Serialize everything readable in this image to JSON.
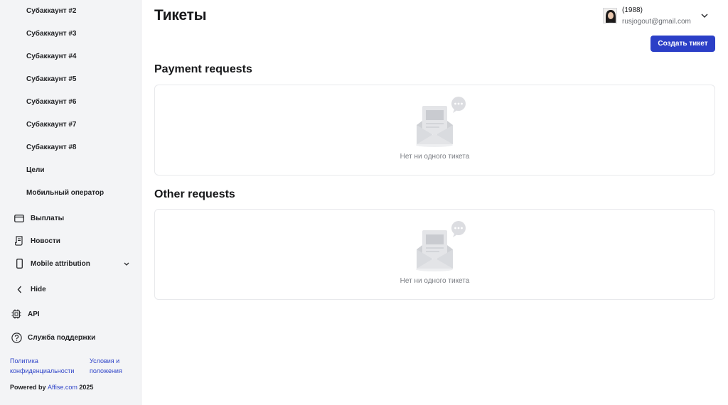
{
  "sidebar": {
    "sub_items": [
      "Субаккаунт #2",
      "Субаккаунт #3",
      "Субаккаунт #4",
      "Субаккаунт #5",
      "Субаккаунт #6",
      "Субаккаунт #7",
      "Субаккаунт #8",
      "Цели",
      "Мобильный оператор"
    ],
    "payouts": {
      "label": "Выплаты",
      "icon": "wallet-icon"
    },
    "news": {
      "label": "Новости",
      "icon": "news-icon"
    },
    "mobile_attribution": {
      "label": "Mobile attribution",
      "icon": "phone-icon"
    },
    "hide": {
      "label": "Hide",
      "icon": "chevron-left-icon"
    },
    "api": {
      "label": "API",
      "icon": "chip-icon"
    },
    "support": {
      "label": "Служба поддержки",
      "icon": "question-icon"
    },
    "footer": {
      "privacy": "Политика конфиденциальности",
      "terms": "Условия и положения",
      "powered_prefix": "Powered by",
      "brand": "Affise.com",
      "year": "2025"
    }
  },
  "header": {
    "title": "Тикеты",
    "user": {
      "name": "(1988)",
      "email": "rusjogout@gmail.com"
    },
    "create_button": "Создать тикет"
  },
  "sections": {
    "payment": {
      "title": "Payment requests",
      "empty_text": "Нет ни одного тикета"
    },
    "other": {
      "title": "Other requests",
      "empty_text": "Нет ни одного тикета"
    }
  },
  "colors": {
    "accent": "#2b3fc7",
    "link": "#2f44c8",
    "sidebar_bg": "#f3f4f6"
  }
}
